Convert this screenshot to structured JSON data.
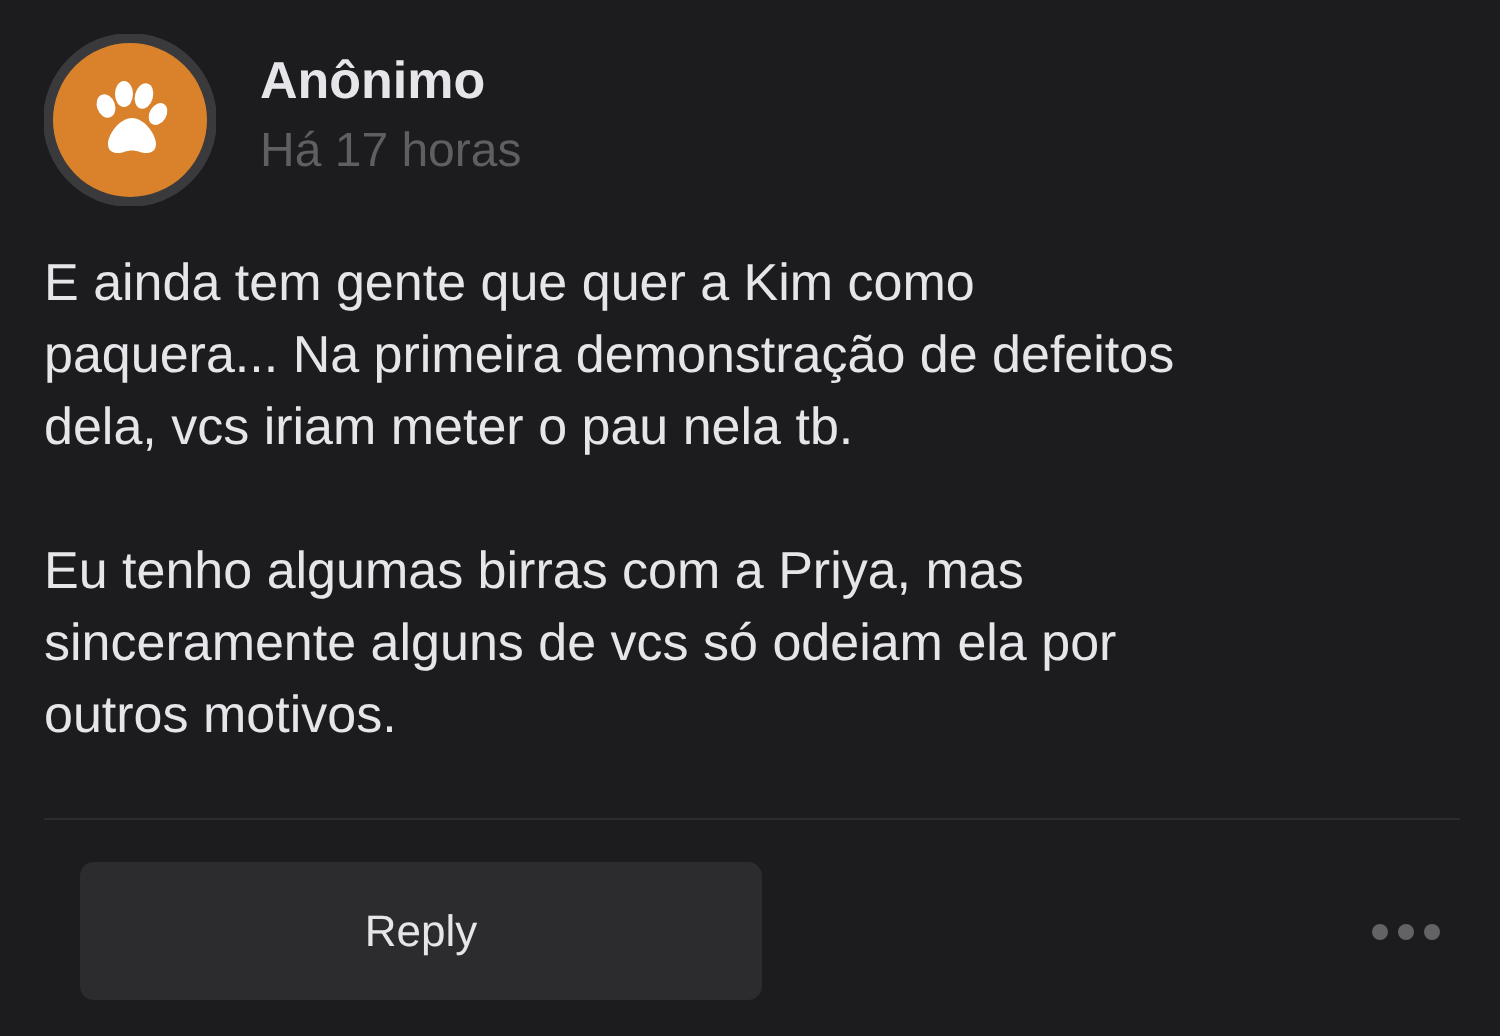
{
  "post": {
    "author": "Anônimo",
    "time": "Há 17 horas",
    "paragraphs": [
      "E ainda tem gente que quer a Kim como\npaquera... Na primeira demonstração de defeitos\ndela, vcs iriam meter o pau nela tb.",
      "Eu tenho algumas birras com a Priya, mas\nsinceramente alguns de vcs só odeiam ela por\noutros motivos."
    ]
  },
  "actions": {
    "reply": "Reply"
  }
}
